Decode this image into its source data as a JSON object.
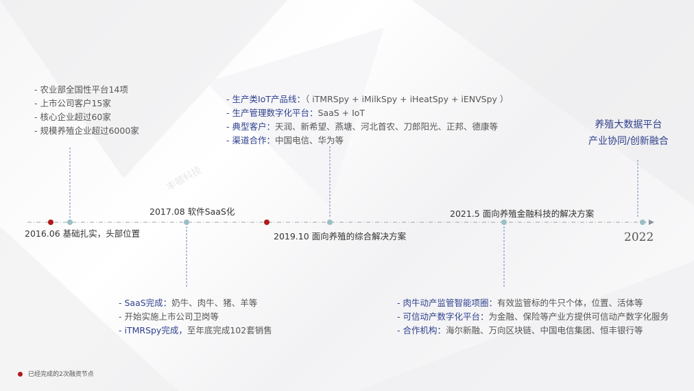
{
  "colors": {
    "accent": "#2e3f8c",
    "milestone_red": "#b01a1a",
    "node_teal": "#9ac0c6",
    "line": "#9aa3ad"
  },
  "milestones": [
    {
      "date": "2016.06 基础扎实，头部位置",
      "financing": true
    },
    {
      "date": "2017.08 软件SaaS化",
      "financing": false
    },
    {
      "date": "2019.10 面向养殖的综合解决方案",
      "financing": true
    },
    {
      "date": "2021.5 面向养殖金融科技的解决方案",
      "financing": false
    },
    {
      "date": "2022",
      "financing": false
    }
  ],
  "block_2016": {
    "lines": [
      "- 农业部全国性平台14项",
      "- 上市公司客户15家",
      "- 核心企业超过60家",
      "- 规模养殖企业超过6000家"
    ]
  },
  "block_2017": {
    "lines": [
      {
        "label": "- SaaS完成：",
        "text": "奶牛、肉牛、猪、羊等"
      },
      {
        "label": "",
        "text": "- 开始实施上市公司卫岗等"
      },
      {
        "label": "- iTMRSpy完成，",
        "text": "至年底完成102套销售"
      }
    ]
  },
  "block_2019": {
    "lines": [
      {
        "label": "- 生产类IoT产品线：",
        "text": "（ iTMRSpy + iMilkSpy + iHeatSpy + iENVSpy   ）"
      },
      {
        "label": "- 生产管理数字化平台：",
        "text": "SaaS + IoT"
      },
      {
        "label": "- 典型客户：",
        "text": "天润、新希望、燕塘、河北首农、刀郎阳光、正邦、德康等"
      },
      {
        "label": "- 渠道合作：",
        "text": "中国电信、华为等"
      }
    ]
  },
  "block_2021": {
    "lines": [
      {
        "label": "- 肉牛动产监管智能项圈：",
        "text": "有效监管标的牛只个体，位置、活体等"
      },
      {
        "label": "- 可信动产数字化平台：",
        "text": "为金融、保险等产业方提供可信动产数字化服务"
      },
      {
        "label": "- 合作机构：",
        "text": "海尔新融、万向区块链、中国电信集团、恒丰银行等"
      }
    ]
  },
  "goal_2022": {
    "line1": "养殖大数据平台",
    "line2": "产业协同/创新融合"
  },
  "legend": {
    "text": "已经完成的2次融资节点"
  },
  "watermark": "丰顿科技"
}
